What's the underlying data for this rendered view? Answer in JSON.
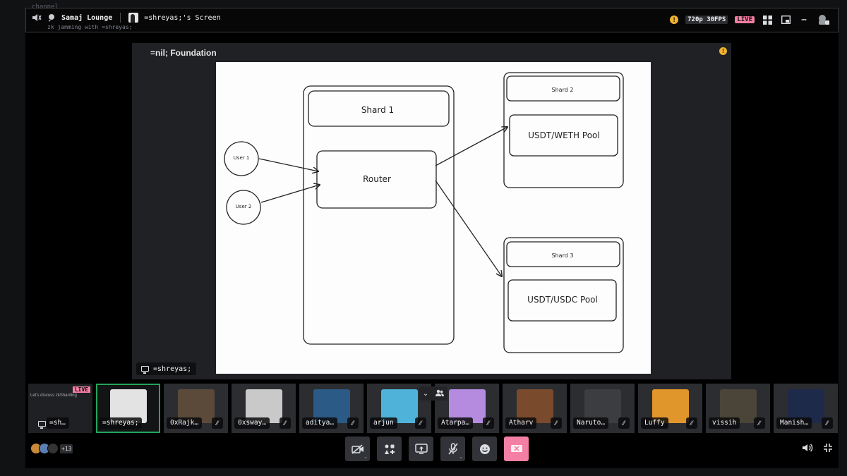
{
  "header": {
    "channel_label": "channel",
    "server_name": "Samaj Lounge",
    "screen_title": "=shreyas;'s Screen",
    "subtitle": "zk jamming with =shreyas;",
    "quality": "720p 30FPS",
    "live": "LIVE"
  },
  "stage": {
    "doc_title": "=nil; Foundation",
    "presenter": "=shreyas;"
  },
  "diagram": {
    "nodes": {
      "shard1": "Shard 1",
      "router": "Router",
      "user1": "User 1",
      "user2": "User 2",
      "shard2": "Shard 2",
      "pool_weth": "USDT/WETH Pool",
      "shard3": "Shard 3",
      "pool_usdc": "USDT/USDC Pool"
    }
  },
  "stream_tile": {
    "name": "=sh…",
    "live": "LIVE",
    "preview_text": "Let's discuss zkSharding"
  },
  "participants": [
    {
      "name": "=shreyas;",
      "color": "#e3e3e3"
    },
    {
      "name": "0xRajk…",
      "color": "#5b4a3a"
    },
    {
      "name": "0xsway…",
      "color": "#c9c9c9"
    },
    {
      "name": "aditya…",
      "color": "#2b5a86"
    },
    {
      "name": "arjun",
      "color": "#4fb3d9"
    },
    {
      "name": "Atarpa…",
      "color": "#b58be0"
    },
    {
      "name": "Atharv",
      "color": "#7a4a2c"
    },
    {
      "name": "Naruto…",
      "color": "#3c3d40"
    },
    {
      "name": "Luffy",
      "color": "#e0962b"
    },
    {
      "name": "vissih",
      "color": "#4a4538"
    },
    {
      "name": "Manish…",
      "color": "#1e2a4a"
    }
  ],
  "footer": {
    "more_count": "+13",
    "controls": [
      "camera-off",
      "activities",
      "share-screen",
      "mute-mic",
      "emoji",
      "leave-stream"
    ]
  },
  "colors": {
    "live": "#f47fa4",
    "speaking": "#23a55a",
    "warning": "#f0b232"
  }
}
